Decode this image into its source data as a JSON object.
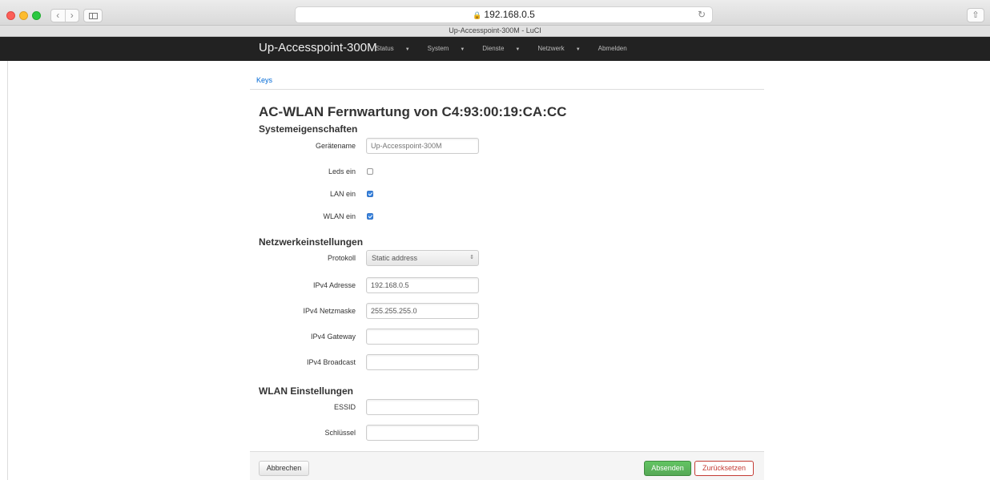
{
  "browser": {
    "url": "192.168.0.5",
    "tab_title": "Up-Accesspoint-300M - LuCI"
  },
  "header": {
    "brand": "Up-Accesspoint-300M",
    "menu": [
      {
        "label": "Status"
      },
      {
        "label": "System"
      },
      {
        "label": "Dienste"
      },
      {
        "label": "Netzwerk"
      },
      {
        "label": "Abmelden"
      }
    ]
  },
  "tabs": {
    "keys": "Keys"
  },
  "page": {
    "title": "AC-WLAN Fernwartung von C4:93:00:19:CA:CC"
  },
  "system": {
    "title": "Systemeigenschaften",
    "hostname_label": "Gerätename",
    "hostname_placeholder": "Up-Accesspoint-300M",
    "leds_label": "Leds ein",
    "leds_checked": false,
    "lan_label": "LAN ein",
    "lan_checked": true,
    "wlan_label": "WLAN ein",
    "wlan_checked": true
  },
  "network": {
    "title": "Netzwerkeinstellungen",
    "protocol_label": "Protokoll",
    "protocol_value": "Static address",
    "ipv4_address_label": "IPv4 Adresse",
    "ipv4_address_value": "192.168.0.5",
    "ipv4_netmask_label": "IPv4 Netzmaske",
    "ipv4_netmask_value": "255.255.255.0",
    "ipv4_gateway_label": "IPv4 Gateway",
    "ipv4_gateway_value": "",
    "ipv4_broadcast_label": "IPv4 Broadcast",
    "ipv4_broadcast_value": ""
  },
  "wlan": {
    "title": "WLAN Einstellungen",
    "essid_label": "ESSID",
    "essid_value": "",
    "key_label": "Schlüssel",
    "key_value": ""
  },
  "actions": {
    "cancel": "Abbrechen",
    "submit": "Absenden",
    "reset": "Zurücksetzen"
  },
  "colors": {
    "header_bg": "#222222",
    "link": "#0069d6",
    "submit_green": "#5bb75b",
    "reset_red": "#c43c35",
    "checkbox_blue": "#3b86e0"
  }
}
